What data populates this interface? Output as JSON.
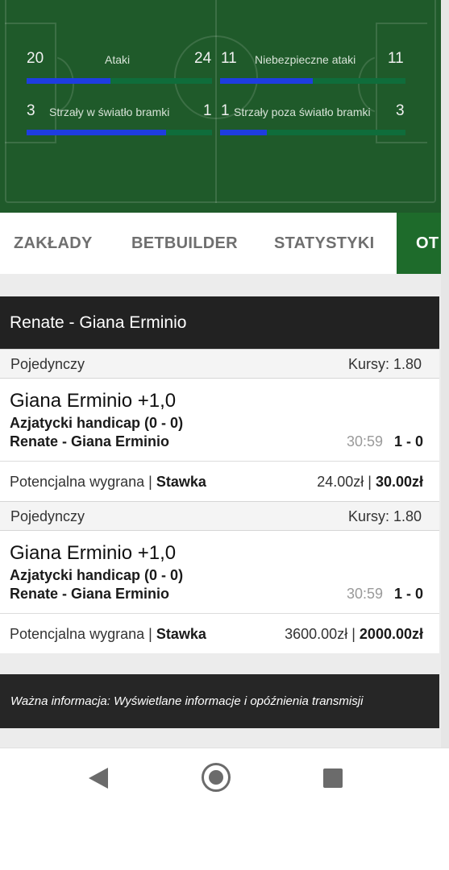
{
  "stats": {
    "attacks": {
      "home": "20",
      "label": "Ataki",
      "away": "24",
      "home_fraction": 0.45
    },
    "dangerous_attacks": {
      "home": "11",
      "label": "Niebezpieczne ataki",
      "away": "11",
      "home_fraction": 0.5
    },
    "shots_on_target": {
      "home": "3",
      "label": "Strzały w światło bramki",
      "away": "1",
      "home_fraction": 0.75
    },
    "shots_off_target": {
      "home": "1",
      "label": "Strzały poza światło bramki",
      "away": "3",
      "home_fraction": 0.25
    }
  },
  "colors": {
    "pitch": "#1f5a2a",
    "bar_home": "#1e3de0",
    "bar_track": "#0f6d3b",
    "tab_active": "#1e6b2b"
  },
  "tabs": [
    "ZAKŁADY",
    "BETBUILDER",
    "STATYSTYKI",
    "OT"
  ],
  "bet_slip": {
    "title": "Renate - Giana Erminio",
    "bets": [
      {
        "type": "Pojedynczy",
        "odds": "Kursy: 1.80",
        "pick": "Giana Erminio +1,0",
        "market": "Azjatycki handicap (0 - 0)",
        "event": "Renate - Giana Erminio",
        "time": "30:59",
        "score": "1 - 0",
        "payout_label": "Potencjalna wygrana",
        "separator": "|",
        "stake_label": "Stawka",
        "payout": "24.00zł",
        "stake": "30.00zł"
      },
      {
        "type": "Pojedynczy",
        "odds": "Kursy: 1.80",
        "pick": "Giana Erminio +1,0",
        "market": "Azjatycki handicap (0 - 0)",
        "event": "Renate - Giana Erminio",
        "time": "30:59",
        "score": "1 - 0",
        "payout_label": "Potencjalna wygrana",
        "separator": "|",
        "stake_label": "Stawka",
        "payout": "3600.00zł",
        "stake": "2000.00zł"
      }
    ]
  },
  "info_banner": "Ważna informacja: Wyświetlane informacje i opóźnienia transmisji",
  "nav_icons": [
    "back-icon",
    "home-icon",
    "recents-icon"
  ]
}
